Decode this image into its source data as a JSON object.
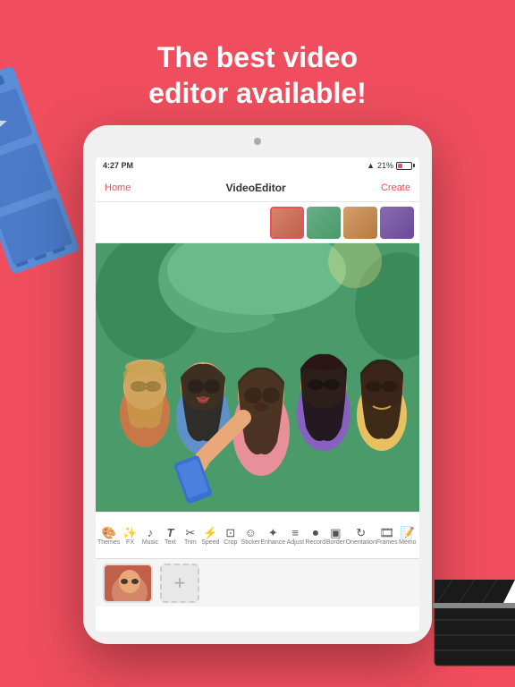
{
  "hero": {
    "title_line1": "The best video",
    "title_line2": "editor available!",
    "bg_color": "#F04E5E"
  },
  "tablet": {
    "status": {
      "time": "4:27 PM",
      "battery_pct": "21%",
      "wifi": true
    },
    "navbar": {
      "home": "Home",
      "title": "VideoEditor",
      "create": "Create"
    },
    "toolbar_items": [
      {
        "icon": "🎨",
        "label": "Themes"
      },
      {
        "icon": "✨",
        "label": "FX"
      },
      {
        "icon": "🎵",
        "label": "Music"
      },
      {
        "icon": "T",
        "label": "Text"
      },
      {
        "icon": "✂️",
        "label": "Trim"
      },
      {
        "icon": "⚡",
        "label": "Speed"
      },
      {
        "icon": "🔲",
        "label": "Crop"
      },
      {
        "icon": "⭐",
        "label": "Sticker"
      },
      {
        "icon": "🌟",
        "label": "Enhance"
      },
      {
        "icon": "≡",
        "label": "Adjust"
      },
      {
        "icon": "⏺",
        "label": "Record"
      },
      {
        "icon": "⬛",
        "label": "Border"
      },
      {
        "icon": "↻",
        "label": "Orientation"
      },
      {
        "icon": "🎞",
        "label": "Frames"
      },
      {
        "icon": "📝",
        "label": "Memo"
      }
    ]
  }
}
